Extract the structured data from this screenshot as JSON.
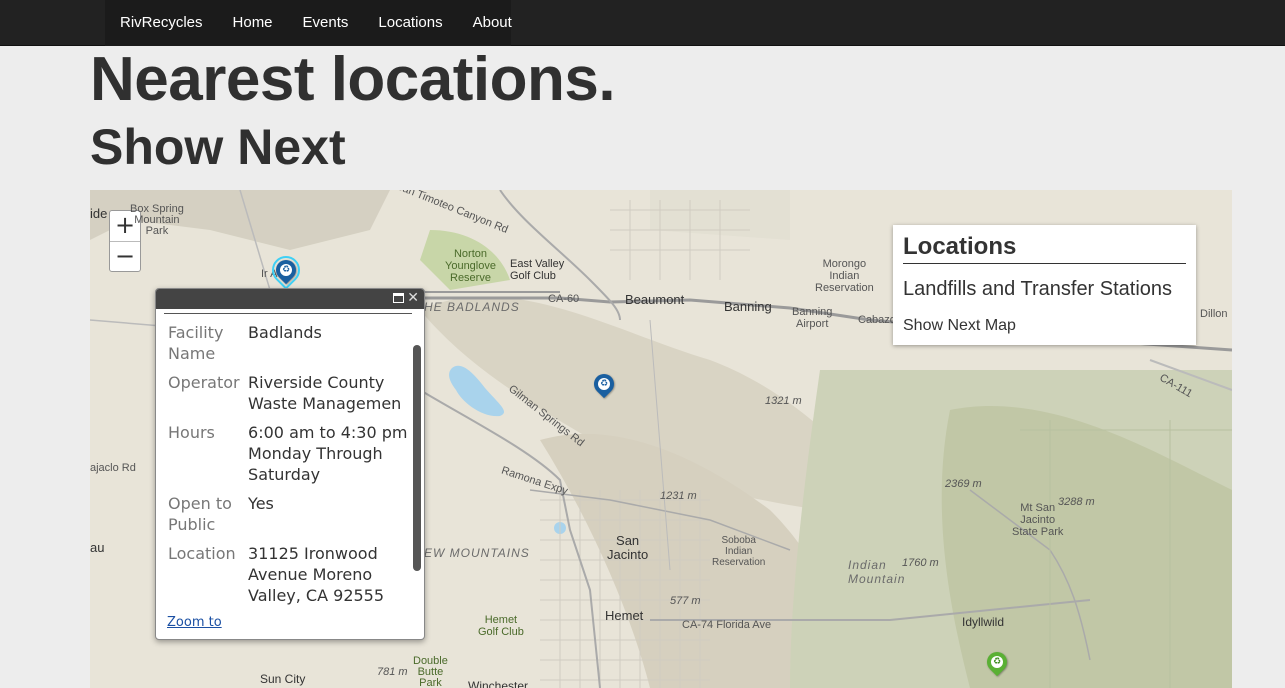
{
  "nav": {
    "brand": "RivRecycles",
    "items": [
      {
        "label": "Home"
      },
      {
        "label": "Events"
      },
      {
        "label": "Locations"
      },
      {
        "label": "About"
      }
    ]
  },
  "page": {
    "title": "Nearest locations.",
    "subtitle": "Show Next"
  },
  "map": {
    "zoom_in": "+",
    "zoom_out": "−",
    "labels": {
      "box_spring": "Box Spring\nMountain\nPark",
      "ide": "ide",
      "norton": "Norton\nYounglove\nReserve",
      "east_valley": "East Valley\nGolf Club",
      "morongo": "Morongo\nIndian\nReservation",
      "beaumont": "Beaumont",
      "banning": "Banning",
      "banning_airport": "Banning\nAirport",
      "cabazon": "Cabazo",
      "dillon": "Dillon",
      "badlands": "HE BADLANDS",
      "ca60": "CA-60",
      "ironwood": "Ir       Ave",
      "gilman": "Gilman Springs Rd",
      "el1321": "1321 m",
      "ramona": "Ramona Expy",
      "el1231": "1231 m",
      "el2369": "2369 m",
      "el3288": "3288 m",
      "mt_san_jacinto": "Mt San\nJacinto\nState Park",
      "san_jacinto": "San\nJacinto",
      "soboba": "Soboba\nIndian\nReservation",
      "indian_mountain": "Indian\nMountain",
      "el1760": "1760 m",
      "mountains": "EW MOUNTAINS",
      "hemet": "Hemet",
      "hemet_golf": "Hemet\nGolf Club",
      "el577": "577 m",
      "florida": "CA-74 Florida Ave",
      "idyllwild": "Idyllwild",
      "double_butte": "Double\nButte\nPark",
      "el781": "781 m",
      "sun_city": "Sun City",
      "winchester": "Winchester",
      "ajaclo": "ajaclo Rd",
      "au": "au",
      "ca111": "CA-111",
      "timoteo": "San Timoteo Canyon Rd"
    },
    "popup": {
      "rows": [
        {
          "key": "Facility Name",
          "value": "Badlands"
        },
        {
          "key": "Operator",
          "value": "Riverside County Waste Management"
        },
        {
          "key": "Hours",
          "value": "6:00 am to 4:30 pm Monday Through Saturday"
        },
        {
          "key": "Open to Public",
          "value": "Yes"
        },
        {
          "key": "Location",
          "value": "31125 Ironwood Avenue Moreno Valley, CA 92555"
        }
      ],
      "close": "✕",
      "zoom_to": "Zoom to"
    },
    "legend": {
      "title": "Locations",
      "subtitle": "Landfills and Transfer Stations",
      "link": "Show Next Map"
    },
    "colors": {
      "pin_blue": "#1a5fa0",
      "pin_green": "#5ab034"
    }
  }
}
